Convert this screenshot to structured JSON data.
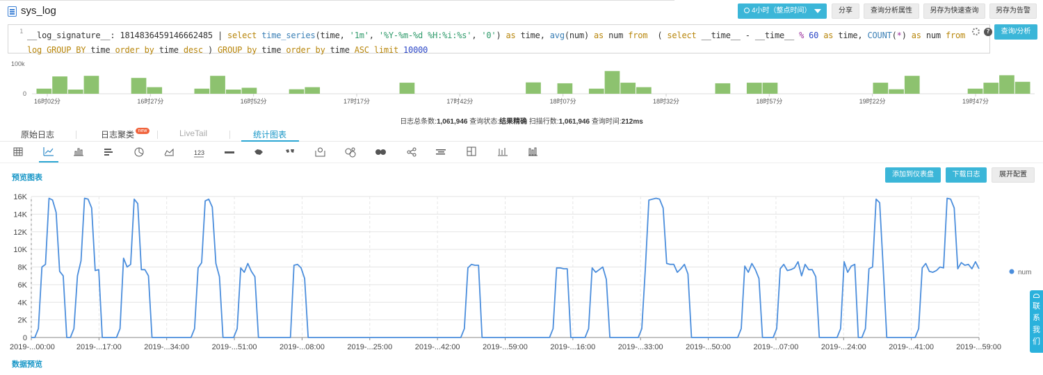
{
  "header": {
    "title": "sys_log",
    "time_button": "4小时（整点时间）",
    "share": "分享",
    "analysis_props": "查询分析属性",
    "save_quick": "另存为快速查询",
    "save_alert": "另存为告警"
  },
  "editor": {
    "line_number": "1",
    "query_button": "查询/分析"
  },
  "histogram": {
    "y_labels": [
      "100k",
      "0"
    ],
    "y_max": 100000,
    "x_labels": [
      "16时02分",
      "16时27分",
      "16时52分",
      "17时17分",
      "17时42分",
      "18时07分",
      "18时32分",
      "18时57分",
      "19时22分",
      "19时47分"
    ],
    "bars": [
      17000,
      58000,
      14000,
      60000,
      0,
      0,
      53000,
      22000,
      0,
      0,
      17000,
      60000,
      14000,
      20000,
      0,
      0,
      15000,
      22000,
      0,
      0,
      0,
      0,
      0,
      37000,
      0,
      0,
      0,
      0,
      0,
      0,
      0,
      38000,
      0,
      35000,
      0,
      17000,
      76000,
      37000,
      22000,
      0,
      0,
      0,
      0,
      35000,
      0,
      37000,
      37000,
      0,
      0,
      0,
      0,
      0,
      0,
      37000,
      15000,
      60000,
      0,
      0,
      0,
      17000,
      37000,
      62000,
      40000
    ],
    "color": "#8dc26f"
  },
  "stats": {
    "total_label": "日志总条数:",
    "total_value": "1,061,946",
    "status_label": "查询状态:",
    "status_value": "结果精确",
    "scan_label": "扫描行数:",
    "scan_value": "1,061,946",
    "time_label": "查询时间:",
    "time_value": "212ms"
  },
  "tabs": {
    "raw": "原始日志",
    "cluster": "日志聚类",
    "new_badge": "new",
    "livetail": "LiveTail",
    "chart": "统计图表"
  },
  "toolbar": {
    "icons": [
      "table-icon",
      "line-chart-icon",
      "bar-chart-icon",
      "horizontal-bar-icon",
      "pie-chart-icon",
      "area-chart-icon",
      "single-value-icon",
      "progress-bar-icon",
      "china-map-icon",
      "world-map-icon",
      "location-map-icon",
      "flow-chart-icon",
      "sankey-icon",
      "word-cloud-icon",
      "treemap-icon",
      "rectangle-tree-icon",
      "candlestick-icon",
      "heatmap-icon"
    ],
    "single_value_text": "123"
  },
  "preview": {
    "title": "预览图表",
    "add_dashboard": "添加到仪表盘",
    "download_log": "下载日志",
    "expand_config": "展开配置"
  },
  "data_preview_title": "数据预览",
  "contact": [
    "联",
    "系",
    "我",
    "们"
  ],
  "chart_data": {
    "type": "line",
    "y_ticks": [
      "16K",
      "14K",
      "12K",
      "10K",
      "8K",
      "6K",
      "4K",
      "2K",
      "0"
    ],
    "ylim": [
      0,
      16000
    ],
    "x_ticks": [
      "2019-...00:00",
      "2019-...17:00",
      "2019-...34:00",
      "2019-...51:00",
      "2019-...08:00",
      "2019-...25:00",
      "2019-...42:00",
      "2019-...59:00",
      "2019-...16:00",
      "2019-...33:00",
      "2019-...50:00",
      "2019-...07:00",
      "2019-...24:00",
      "2019-...41:00",
      "2019-...59:00"
    ],
    "series": [
      {
        "name": "num",
        "color": "#4a8ddc",
        "values": [
          0,
          0,
          1000,
          8000,
          8300,
          15800,
          15600,
          14200,
          7500,
          7000,
          0,
          0,
          1000,
          7000,
          8700,
          15800,
          15700,
          14700,
          7600,
          7700,
          0,
          0,
          0,
          0,
          0,
          1000,
          9000,
          8000,
          8300,
          15700,
          15200,
          7700,
          7700,
          7000,
          0,
          0,
          0,
          0,
          0,
          0,
          0,
          0,
          0,
          0,
          0,
          0,
          1000,
          7900,
          8500,
          15500,
          15700,
          14800,
          8400,
          6900,
          0,
          0,
          0,
          0,
          1000,
          7900,
          7400,
          8400,
          7500,
          6900,
          0,
          0,
          0,
          0,
          0,
          0,
          0,
          0,
          0,
          0,
          8200,
          8300,
          7900,
          6700,
          0,
          0,
          0,
          0,
          0,
          0,
          0,
          0,
          0,
          0,
          0,
          0,
          0,
          0,
          0,
          0,
          0,
          0,
          0,
          0,
          0,
          0,
          0,
          0,
          0,
          0,
          0,
          0,
          0,
          0,
          0,
          0,
          0,
          0,
          0,
          0,
          0,
          0,
          0,
          0,
          0,
          0,
          0,
          0,
          1000,
          7900,
          8300,
          8200,
          8200,
          0,
          0,
          0,
          0,
          0,
          0,
          0,
          0,
          0,
          0,
          0,
          0,
          0,
          0,
          0,
          0,
          0,
          0,
          0,
          0,
          1000,
          7900,
          7900,
          7800,
          7800,
          0,
          0,
          0,
          0,
          0,
          1000,
          7900,
          7400,
          7700,
          8000,
          6600,
          0,
          0,
          0,
          0,
          0,
          0,
          0,
          0,
          0,
          1000,
          7800,
          15600,
          15700,
          15800,
          15700,
          14700,
          8400,
          8300,
          8300,
          7400,
          7800,
          8300,
          7200,
          0,
          0,
          0,
          0,
          0,
          0,
          0,
          0,
          0,
          0,
          0,
          0,
          0,
          0,
          1000,
          8100,
          7400,
          8400,
          7700,
          6700,
          0,
          0,
          0,
          0,
          1000,
          7800,
          8300,
          7600,
          7700,
          7900,
          8600,
          7000,
          8300,
          7700,
          7700,
          6900,
          0,
          0,
          0,
          0,
          0,
          0,
          1000,
          8600,
          7400,
          8100,
          8300,
          0,
          0,
          1000,
          7800,
          8000,
          15700,
          15300,
          7900,
          0,
          0,
          0,
          0,
          0,
          0,
          0,
          0,
          0,
          1000,
          7900,
          8400,
          7500,
          7400,
          7600,
          8000,
          7900,
          15800,
          15700,
          14700,
          7800,
          8500,
          8200,
          8300,
          7800,
          8600,
          7800
        ]
      }
    ]
  }
}
